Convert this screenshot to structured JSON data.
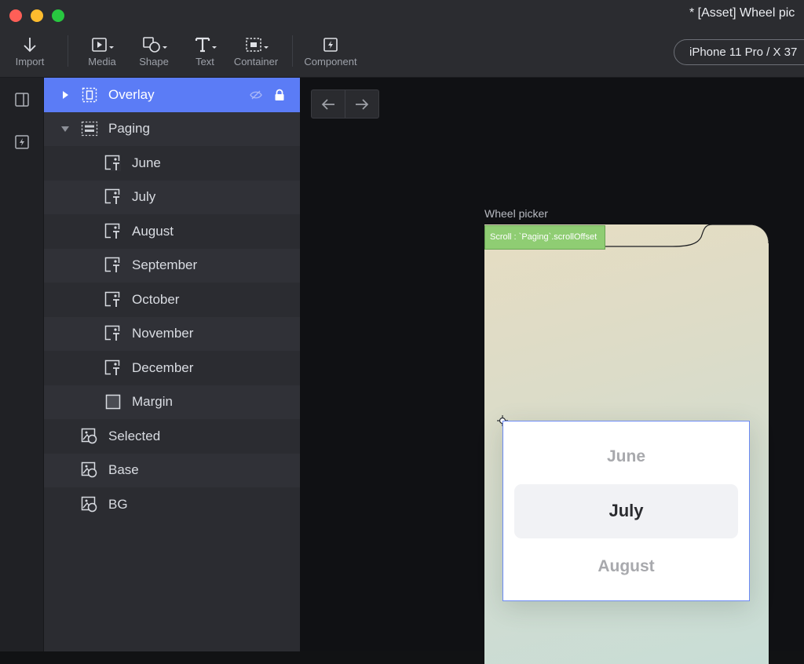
{
  "window": {
    "title": "* [Asset] Wheel pic"
  },
  "toolbar": {
    "items": [
      {
        "label": "Import",
        "icon": "arrow-down-icon"
      },
      {
        "label": "Media",
        "icon": "media-icon"
      },
      {
        "label": "Shape",
        "icon": "shape-icon"
      },
      {
        "label": "Text",
        "icon": "text-icon"
      },
      {
        "label": "Container",
        "icon": "container-icon"
      },
      {
        "label": "Component",
        "icon": "component-icon"
      }
    ],
    "device": "iPhone 11 Pro / X  37"
  },
  "layers": [
    {
      "name": "Overlay",
      "icon": "container-icon",
      "selected": true
    },
    {
      "name": "Paging",
      "icon": "paging-icon",
      "expanded": true
    },
    {
      "name": "June",
      "icon": "text-layer-icon"
    },
    {
      "name": "July",
      "icon": "text-layer-icon"
    },
    {
      "name": "August",
      "icon": "text-layer-icon"
    },
    {
      "name": "September",
      "icon": "text-layer-icon"
    },
    {
      "name": "October",
      "icon": "text-layer-icon"
    },
    {
      "name": "November",
      "icon": "text-layer-icon"
    },
    {
      "name": "December",
      "icon": "text-layer-icon"
    },
    {
      "name": "Margin",
      "icon": "rectangle-icon"
    },
    {
      "name": "Selected",
      "icon": "shape-layer-icon"
    },
    {
      "name": "Base",
      "icon": "shape-layer-icon"
    },
    {
      "name": "BG",
      "icon": "shape-layer-icon"
    }
  ],
  "canvas": {
    "frame_label": "Wheel picker",
    "scroll_badge": "Scroll : `Paging`.scrollOffset",
    "picker": {
      "above": "June",
      "selected": "July",
      "below": "August"
    }
  },
  "colors": {
    "accent": "#5b7cf6",
    "scroll_badge": "#8fcd73"
  }
}
